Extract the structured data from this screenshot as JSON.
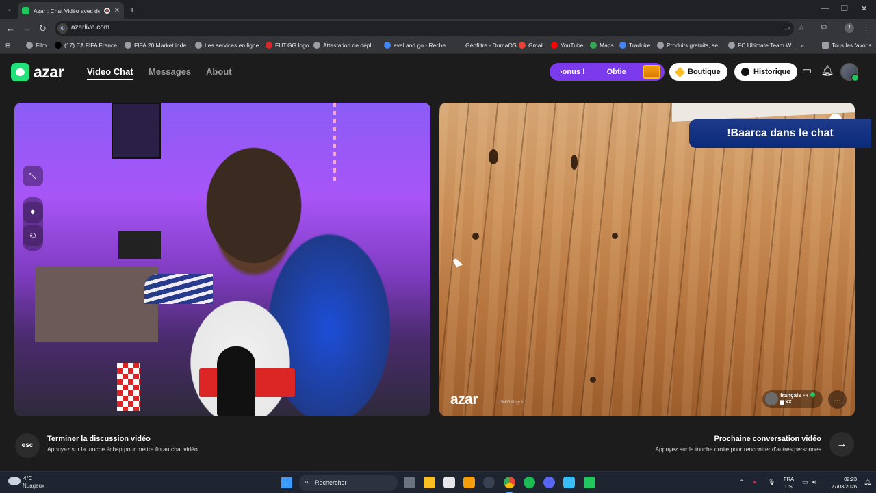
{
  "browser": {
    "tab_title": "Azar : Chat Vidéo avec de n",
    "tab_close": "✕",
    "new_tab": "+",
    "url": "azarlive.com",
    "profile_initial": "f",
    "bookmarks": [
      {
        "label": "Film",
        "color": "#9aa0a6"
      },
      {
        "label": "(17) EA FIFA France...",
        "color": "#000000"
      },
      {
        "label": "FIFA 20 Market inde...",
        "color": "#9aa0a6"
      },
      {
        "label": "Les services en ligne...",
        "color": "#9aa0a6"
      },
      {
        "label": "FUT.GG logo",
        "color": "#dc2626"
      },
      {
        "label": "Attestation de dépl...",
        "color": "#9aa0a6"
      },
      {
        "label": "eval and go - Reche...",
        "color": "#4285f4"
      },
      {
        "label": "Géofiltre - DumaOS",
        "color": "#35363a"
      },
      {
        "label": "Gmail",
        "color": "#ea4335"
      },
      {
        "label": "YouTube",
        "color": "#ff0000"
      },
      {
        "label": "Maps",
        "color": "#34a853"
      },
      {
        "label": "Traduire",
        "color": "#4285f4"
      },
      {
        "label": "Produits gratuits, se...",
        "color": "#9aa0a6"
      },
      {
        "label": "FC Ultimate Team W...",
        "color": "#9aa0a6"
      }
    ],
    "all_bookmarks": "Tous les favoris"
  },
  "header": {
    "logo_text": "azar",
    "nav": [
      "Video Chat",
      "Messages",
      "About"
    ],
    "promo_left": "›onus !",
    "promo_right": "Obtie",
    "shop_label": "Boutique",
    "history_label": "Historique",
    "accent_color": "#7c3aed",
    "brand_color": "#22e07a"
  },
  "video": {
    "overlay_text": "!Baarca dans le chat",
    "watermark": "azar",
    "watermark_id": "J5W8IKhgy9",
    "peer_language": "français",
    "peer_language_code": "FR",
    "peer_location": "XX"
  },
  "footer": {
    "esc_label": "esc",
    "end_title": "Terminer la discussion vidéo",
    "end_sub": "Appuyez sur la touche échap pour mettre fin au chat vidéo.",
    "next_title": "Prochaine conversation vidéo",
    "next_sub": "Appuyez sur la touche droite pour rencontrer d'autres personnes",
    "next_icon": "→"
  },
  "taskbar": {
    "temperature": "4°C",
    "weather": "Nuageux",
    "search_placeholder": "Rechercher",
    "lang_top": "FRA",
    "lang_bottom": "US",
    "time": "02:23",
    "date": "27/03/2026"
  }
}
